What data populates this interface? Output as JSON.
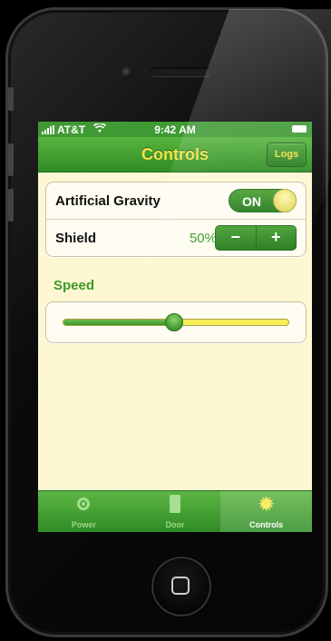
{
  "status_bar": {
    "carrier": "AT&T",
    "time": "9:42 AM"
  },
  "nav": {
    "title": "Controls",
    "logs_label": "Logs"
  },
  "settings": {
    "gravity": {
      "label": "Artificial Gravity",
      "toggle_text": "ON",
      "on": true
    },
    "shield": {
      "label": "Shield",
      "value": "50%",
      "minus": "−",
      "plus": "+"
    }
  },
  "speed": {
    "label": "Speed",
    "level": 0.49
  },
  "tabs": [
    {
      "label": "Power",
      "icon": "power-icon"
    },
    {
      "label": "Door",
      "icon": "door-icon"
    },
    {
      "label": "Controls",
      "icon": "gear-icon",
      "active": true
    }
  ],
  "colors": {
    "accent_green": "#3f9a34",
    "accent_yellow": "#f2e24a",
    "background": "#fdf7d3"
  }
}
